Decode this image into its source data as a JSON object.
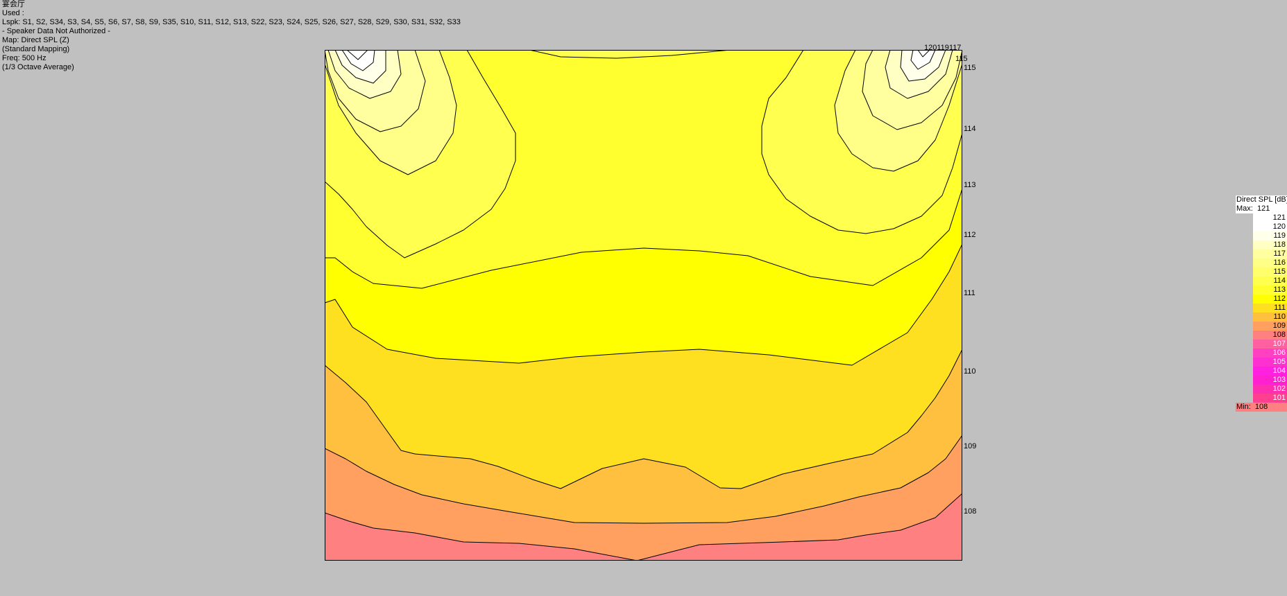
{
  "info": {
    "room": "宴会厅",
    "used": "Used :",
    "lspk": "Lspk: S1, S2, S34, S3, S4, S5, S6, S7, S8, S9, S35, S10, S11, S12, S13, S22, S23, S24, S25, S26, S27, S28, S29, S30, S31, S32, S33",
    "auth": "- Speaker Data Not Authorized -",
    "map": "Map: Direct SPL (Z)",
    "mapping": "(Standard Mapping)",
    "freq": "Freq: 500 Hz",
    "average": "(1/3 Octave Average)"
  },
  "contour_labels": {
    "top_cluster": "120119117",
    "l115a": "115",
    "l115b": "115",
    "l114": "114",
    "l113": "113",
    "l112": "112",
    "l111": "111",
    "l110": "110",
    "l109": "109",
    "l108": "108"
  },
  "legend": {
    "title": "Direct SPL [dB]",
    "max_label": "Max:",
    "max_value": "121",
    "min_label": "Min:",
    "min_value": "108",
    "levels": [
      {
        "value": "121",
        "color": "#ffffff"
      },
      {
        "value": "120",
        "color": "#ffffff"
      },
      {
        "value": "119",
        "color": "#ffffea"
      },
      {
        "value": "118",
        "color": "#ffffc4"
      },
      {
        "value": "117",
        "color": "#ffffa0"
      },
      {
        "value": "116",
        "color": "#ffff88"
      },
      {
        "value": "115",
        "color": "#ffff6c"
      },
      {
        "value": "114",
        "color": "#ffff50"
      },
      {
        "value": "113",
        "color": "#ffff30"
      },
      {
        "value": "112",
        "color": "#ffff00"
      },
      {
        "value": "111",
        "color": "#ffe020"
      },
      {
        "value": "110",
        "color": "#ffc040"
      },
      {
        "value": "109",
        "color": "#ffa060"
      },
      {
        "value": "108",
        "color": "#ff8080"
      },
      {
        "value": "107",
        "color": "#ff60a0"
      },
      {
        "value": "106",
        "color": "#ff40c0"
      },
      {
        "value": "105",
        "color": "#ff30d0"
      },
      {
        "value": "104",
        "color": "#ff20e0"
      },
      {
        "value": "103",
        "color": "#ff20d0"
      },
      {
        "value": "102",
        "color": "#ff30b0"
      },
      {
        "value": "101",
        "color": "#ff4090"
      }
    ]
  }
}
